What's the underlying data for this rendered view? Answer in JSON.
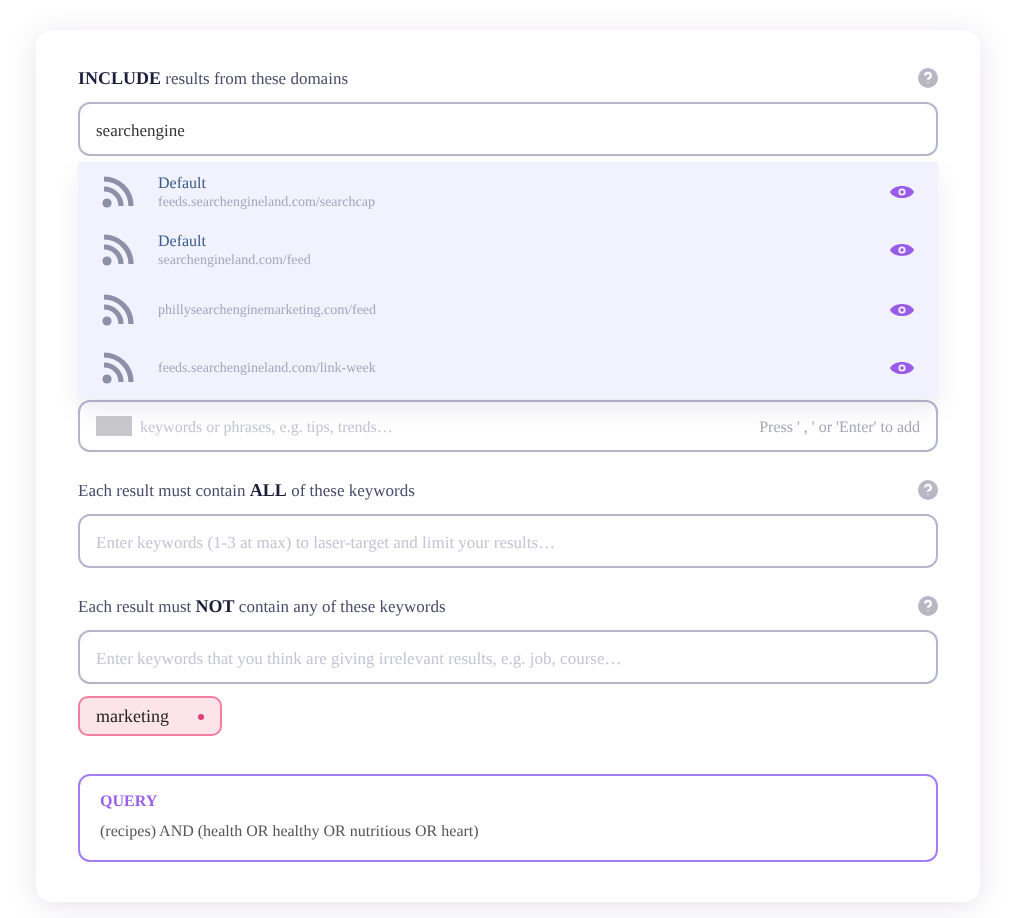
{
  "include": {
    "label": "**INCLUDE** results from these domains",
    "value": "searchengine",
    "suggestions": [
      {
        "title": "Default",
        "url": "feeds.searchengineland.com/searchcap"
      },
      {
        "title": "Default",
        "url": "searchengineland.com/feed"
      },
      {
        "url": "phillysearchenginemarketing.com/feed"
      },
      {
        "url": "feeds.searchengineland.com/link-week"
      }
    ]
  },
  "any": {
    "placeholder": "keywords or phrases, e.g. tips, trends…",
    "hint": "Press ' , ' or 'Enter' to add"
  },
  "all": {
    "label": "Each result must contain **ALL** of these keywords",
    "placeholder": "Enter keywords (1-3 at max) to laser-target and limit your results…"
  },
  "not": {
    "label": "Each result must **NOT** contain any of these keywords",
    "placeholder": "Enter keywords that you think are giving irrelevant results, e.g. job, course…",
    "tags": [
      "marketing"
    ]
  },
  "query": {
    "title": "QUERY",
    "text": "(recipes) AND (health OR healthy OR nutritious OR heart)"
  }
}
